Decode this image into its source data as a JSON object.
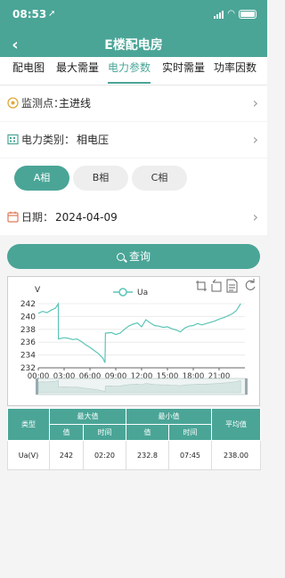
{
  "status_bar": {
    "time": "08:53",
    "location_glyph": "➚"
  },
  "nav": {
    "title": "E楼配电房"
  },
  "tabs": [
    {
      "label": "配电图"
    },
    {
      "label": "最大需量"
    },
    {
      "label": "电力参数"
    },
    {
      "label": "实时需量"
    },
    {
      "label": "功率因数"
    }
  ],
  "active_tab": 2,
  "filters": {
    "monitor_point": {
      "label": "监测点：",
      "value": "主进线"
    },
    "power_type": {
      "label": "电力类别：",
      "value": "相电压"
    },
    "phases": [
      "A相",
      "B相",
      "C相"
    ],
    "active_phase": 0,
    "date": {
      "label": "日期：",
      "value": "2024-04-09"
    }
  },
  "query_label": "查询",
  "colors": {
    "accent": "#4aa597",
    "series": "#5cc5b7"
  },
  "chart_data": {
    "type": "line",
    "ylabel": "V",
    "ylim": [
      232,
      242
    ],
    "yticks": [
      232,
      234,
      236,
      238,
      240,
      242
    ],
    "xlim": [
      0,
      24
    ],
    "xticks": [
      "00:00",
      "03:00",
      "06:00",
      "09:00",
      "12:00",
      "15:00",
      "18:00",
      "21:00"
    ],
    "legend": {
      "position": "top-center"
    },
    "toolbox": [
      "zoom",
      "zoom-reset",
      "data-view",
      "restore"
    ],
    "series": [
      {
        "name": "Ua",
        "x": [
          0,
          0.5,
          1,
          1.5,
          2,
          2.33,
          2.34,
          3,
          3.5,
          4,
          4.5,
          5,
          5.5,
          6,
          6.5,
          7,
          7.5,
          7.75,
          7.8,
          8.5,
          9,
          9.5,
          10,
          10.5,
          11,
          11.5,
          12,
          12.5,
          13,
          13.5,
          14,
          14.5,
          15,
          15.5,
          16,
          16.5,
          17,
          17.5,
          18,
          18.5,
          19,
          19.5,
          20,
          20.5,
          21,
          21.5,
          22,
          22.5,
          23,
          23.5
        ],
        "y": [
          240.5,
          240.8,
          240.6,
          241.0,
          241.3,
          242,
          236.5,
          236.7,
          236.6,
          236.4,
          236.5,
          236.1,
          235.6,
          235.2,
          234.7,
          234.2,
          233.5,
          232.8,
          237.4,
          237.5,
          237.2,
          237.4,
          238.0,
          238.5,
          238.8,
          239.0,
          238.4,
          239.5,
          239.0,
          238.6,
          238.5,
          238.3,
          238.4,
          238.1,
          237.9,
          237.6,
          238.2,
          238.5,
          238.6,
          238.9,
          238.7,
          238.9,
          239.1,
          239.3,
          239.6,
          239.8,
          240.1,
          240.4,
          240.9,
          242.0
        ]
      }
    ],
    "grid": true
  },
  "stats_table": {
    "headers": {
      "type": "类型",
      "max": "最大值",
      "min": "最小值",
      "avg": "平均值",
      "value": "值",
      "time": "时间"
    },
    "row": {
      "type": "Ua(V)",
      "max_value": "242",
      "max_time": "02:20",
      "min_value": "232.8",
      "min_time": "07:45",
      "avg": "238.00"
    }
  }
}
